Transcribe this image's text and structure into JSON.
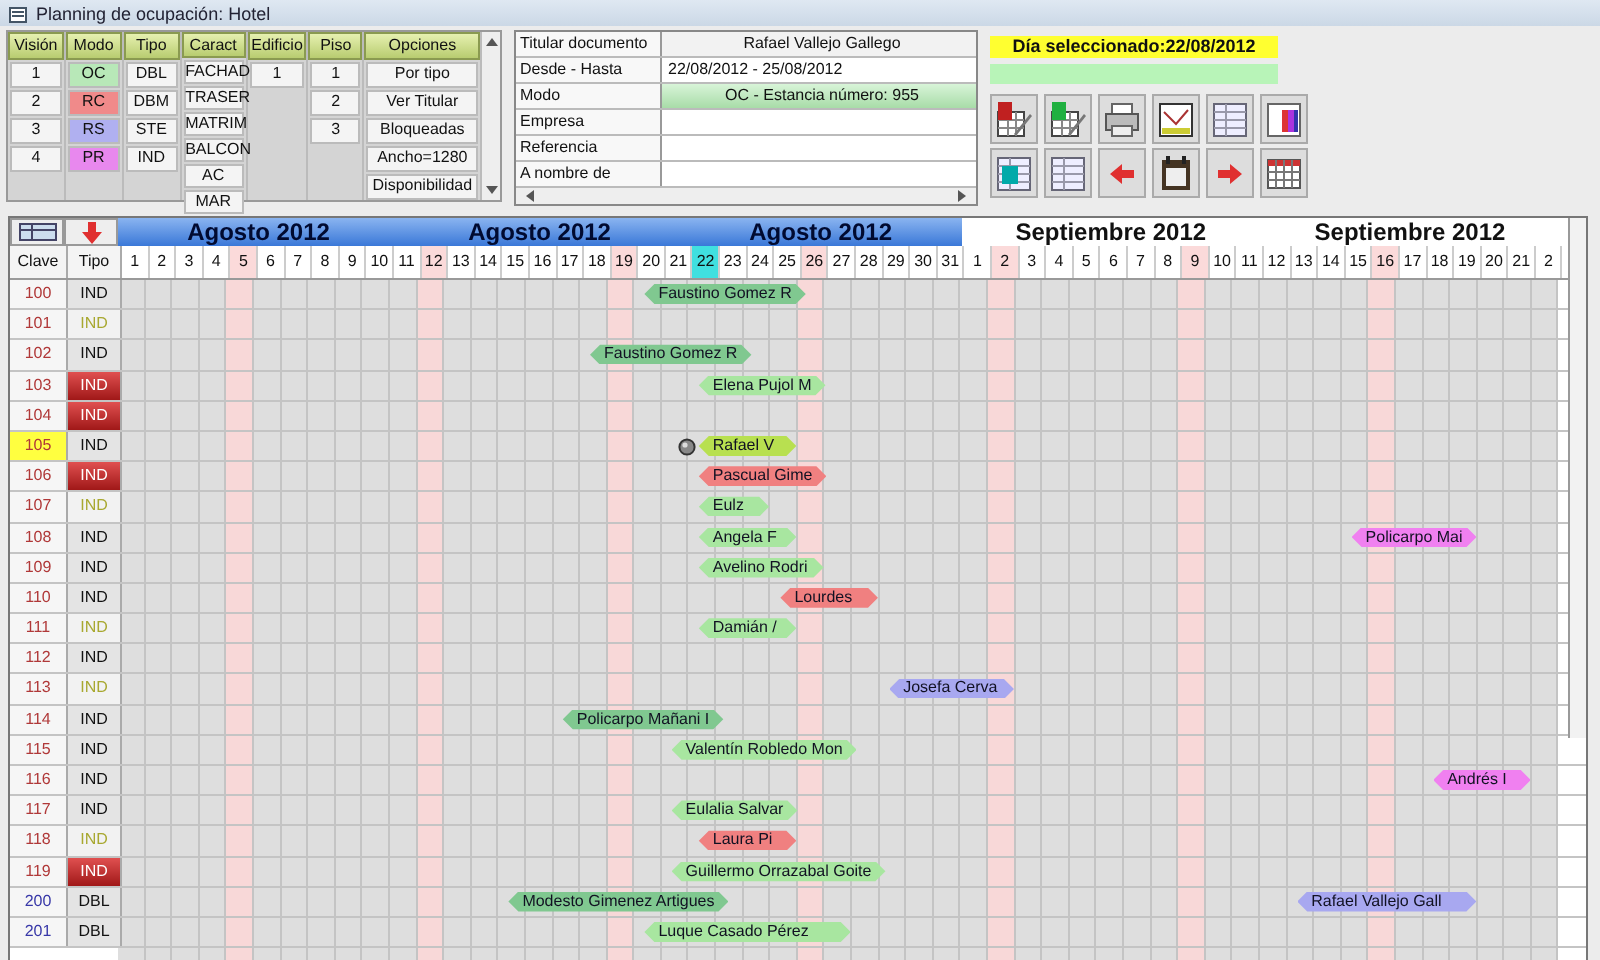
{
  "window": {
    "title": "Planning de ocupación: Hotel"
  },
  "filters": [
    {
      "header": "Visión",
      "items": [
        {
          "label": "1"
        },
        {
          "label": "2"
        },
        {
          "label": "3"
        },
        {
          "label": "4"
        }
      ]
    },
    {
      "header": "Modo",
      "items": [
        {
          "label": "OC",
          "color": "#b8e8b8"
        },
        {
          "label": "RC",
          "color": "#f08a8a"
        },
        {
          "label": "RS",
          "color": "#b0b0f0"
        },
        {
          "label": "PR",
          "color": "#e888ee"
        }
      ]
    },
    {
      "header": "Tipo",
      "items": [
        {
          "label": "DBL"
        },
        {
          "label": "DBM"
        },
        {
          "label": "STE"
        },
        {
          "label": "IND"
        }
      ]
    },
    {
      "header": "Caract",
      "items": [
        {
          "label": "FACHAD"
        },
        {
          "label": "TRASER"
        },
        {
          "label": "MATRIM"
        },
        {
          "label": "BALCON"
        },
        {
          "label": "AC"
        },
        {
          "label": "MAR"
        }
      ]
    },
    {
      "header": "Edificio",
      "items": [
        {
          "label": "1"
        }
      ]
    },
    {
      "header": "Piso",
      "items": [
        {
          "label": "1"
        },
        {
          "label": "2"
        },
        {
          "label": "3"
        }
      ]
    },
    {
      "header": "Opciones",
      "items": [
        {
          "label": "Por tipo"
        },
        {
          "label": "Ver Titular"
        },
        {
          "label": "Bloqueadas"
        },
        {
          "label": "Ancho=1280"
        },
        {
          "label": "Disponibilidad"
        }
      ]
    }
  ],
  "details": [
    {
      "label": "Titular documento",
      "value": "Rafael Vallejo Gallego",
      "kind": "center"
    },
    {
      "label": "Desde - Hasta",
      "value": "22/08/2012 - 25/08/2012",
      "kind": "left"
    },
    {
      "label": "Modo",
      "value": "OC - Estancia número: 955",
      "kind": "highlight"
    },
    {
      "label": "Empresa",
      "kind": "left"
    },
    {
      "label": "Referencia",
      "kind": "left"
    },
    {
      "label": "A nombre de",
      "kind": "left"
    }
  ],
  "selected_day": "Día seleccionado:22/08/2012",
  "toolbar": [
    {
      "kind": "edit-red"
    },
    {
      "kind": "edit-green"
    },
    {
      "kind": "printer"
    },
    {
      "kind": "chart"
    },
    {
      "kind": "table"
    },
    {
      "kind": "colors"
    },
    {
      "kind": "list-c"
    },
    {
      "kind": "list"
    },
    {
      "kind": "left"
    },
    {
      "kind": "calendar"
    },
    {
      "kind": "right"
    },
    {
      "kind": "grid"
    }
  ],
  "columns": {
    "clave": "Clave",
    "tipo": "Tipo"
  },
  "months": [
    {
      "labels": [
        "Agosto 2012",
        "Agosto 2012",
        "Agosto 2012"
      ],
      "highlighted": true,
      "days": [
        {
          "label": "1",
          "sunday": false,
          "selected": false
        },
        {
          "label": "2",
          "sunday": false,
          "selected": false
        },
        {
          "label": "3",
          "sunday": false,
          "selected": false
        },
        {
          "label": "4",
          "sunday": false,
          "selected": false
        },
        {
          "label": "5",
          "sunday": true,
          "selected": false
        },
        {
          "label": "6",
          "sunday": false,
          "selected": false
        },
        {
          "label": "7",
          "sunday": false,
          "selected": false
        },
        {
          "label": "8",
          "sunday": false,
          "selected": false
        },
        {
          "label": "9",
          "sunday": false,
          "selected": false
        },
        {
          "label": "10",
          "sunday": false,
          "selected": false
        },
        {
          "label": "11",
          "sunday": false,
          "selected": false
        },
        {
          "label": "12",
          "sunday": true,
          "selected": false
        },
        {
          "label": "13",
          "sunday": false,
          "selected": false
        },
        {
          "label": "14",
          "sunday": false,
          "selected": false
        },
        {
          "label": "15",
          "sunday": false,
          "selected": false
        },
        {
          "label": "16",
          "sunday": false,
          "selected": false
        },
        {
          "label": "17",
          "sunday": false,
          "selected": false
        },
        {
          "label": "18",
          "sunday": false,
          "selected": false
        },
        {
          "label": "19",
          "sunday": true,
          "selected": false
        },
        {
          "label": "20",
          "sunday": false,
          "selected": false
        },
        {
          "label": "21",
          "sunday": false,
          "selected": false
        },
        {
          "label": "22",
          "sunday": false,
          "selected": true
        },
        {
          "label": "23",
          "sunday": false,
          "selected": false
        },
        {
          "label": "24",
          "sunday": false,
          "selected": false
        },
        {
          "label": "25",
          "sunday": false,
          "selected": false
        },
        {
          "label": "26",
          "sunday": true,
          "selected": false
        },
        {
          "label": "27",
          "sunday": false,
          "selected": false
        },
        {
          "label": "28",
          "sunday": false,
          "selected": false
        },
        {
          "label": "29",
          "sunday": false,
          "selected": false
        },
        {
          "label": "30",
          "sunday": false,
          "selected": false
        },
        {
          "label": "31",
          "sunday": false,
          "selected": false
        }
      ]
    },
    {
      "labels": [
        "Septiembre 2012",
        "Septiembre 2012"
      ],
      "highlighted": false,
      "days": [
        {
          "label": "1",
          "sunday": false,
          "selected": false
        },
        {
          "label": "2",
          "sunday": true,
          "selected": false
        },
        {
          "label": "3",
          "sunday": false,
          "selected": false
        },
        {
          "label": "4",
          "sunday": false,
          "selected": false
        },
        {
          "label": "5",
          "sunday": false,
          "selected": false
        },
        {
          "label": "6",
          "sunday": false,
          "selected": false
        },
        {
          "label": "7",
          "sunday": false,
          "selected": false
        },
        {
          "label": "8",
          "sunday": false,
          "selected": false
        },
        {
          "label": "9",
          "sunday": true,
          "selected": false
        },
        {
          "label": "10",
          "sunday": false,
          "selected": false
        },
        {
          "label": "11",
          "sunday": false,
          "selected": false
        },
        {
          "label": "12",
          "sunday": false,
          "selected": false
        },
        {
          "label": "13",
          "sunday": false,
          "selected": false
        },
        {
          "label": "14",
          "sunday": false,
          "selected": false
        },
        {
          "label": "15",
          "sunday": false,
          "selected": false
        },
        {
          "label": "16",
          "sunday": true,
          "selected": false
        },
        {
          "label": "17",
          "sunday": false,
          "selected": false
        },
        {
          "label": "18",
          "sunday": false,
          "selected": false
        },
        {
          "label": "19",
          "sunday": false,
          "selected": false
        },
        {
          "label": "20",
          "sunday": false,
          "selected": false
        },
        {
          "label": "21",
          "sunday": false,
          "selected": false
        },
        {
          "label": "2",
          "sunday": false,
          "selected": false
        }
      ]
    }
  ],
  "rooms": [
    {
      "clave": "100",
      "tipo": "IND",
      "kind": "normal",
      "selected": false,
      "color": "#b03838",
      "bookings": [
        {
          "guest": "Faustino Gomez R",
          "color": "#80c890",
          "pinned": false
        }
      ]
    },
    {
      "clave": "101",
      "tipo": "IND",
      "kind": "pale",
      "selected": false,
      "color": "#b03838"
    },
    {
      "clave": "102",
      "tipo": "IND",
      "kind": "normal",
      "selected": false,
      "color": "#b03838",
      "bookings": [
        {
          "guest": "Faustino Gomez R",
          "color": "#80c890",
          "pinned": false
        }
      ]
    },
    {
      "clave": "103",
      "tipo": "IND",
      "kind": "blocked",
      "selected": false,
      "color": "#b03838",
      "bookings": [
        {
          "guest": "Elena Pujol M",
          "color": "#a8e6a0",
          "pinned": false
        }
      ]
    },
    {
      "clave": "104",
      "tipo": "IND",
      "kind": "blocked",
      "selected": false,
      "color": "#b03838"
    },
    {
      "clave": "105",
      "tipo": "IND",
      "kind": "normal",
      "selected": true,
      "color": "#b03838",
      "bookings": [
        {
          "guest": "Rafael V",
          "color": "#b8e050",
          "pinned": true
        }
      ]
    },
    {
      "clave": "106",
      "tipo": "IND",
      "kind": "blocked",
      "selected": false,
      "color": "#b03838",
      "bookings": [
        {
          "guest": "Pascual Gime",
          "color": "#f08080",
          "pinned": false
        }
      ]
    },
    {
      "clave": "107",
      "tipo": "IND",
      "kind": "pale",
      "selected": false,
      "color": "#b03838",
      "bookings": [
        {
          "guest": "Eulz",
          "color": "#a8e6a0",
          "pinned": false
        }
      ]
    },
    {
      "clave": "108",
      "tipo": "IND",
      "kind": "normal",
      "selected": false,
      "color": "#b03838",
      "bookings": [
        {
          "guest": "Angela F",
          "color": "#a8e6a0",
          "pinned": false
        },
        {
          "guest": "Policarpo Mai",
          "color": "#f080f0",
          "pinned": false
        }
      ]
    },
    {
      "clave": "109",
      "tipo": "IND",
      "kind": "normal",
      "selected": false,
      "color": "#b03838",
      "bookings": [
        {
          "guest": "Avelino Rodri",
          "color": "#a8e6a0",
          "pinned": false
        }
      ]
    },
    {
      "clave": "110",
      "tipo": "IND",
      "kind": "normal",
      "selected": false,
      "color": "#b03838",
      "bookings": [
        {
          "guest": "Lourdes",
          "color": "#f08080",
          "pinned": false
        }
      ]
    },
    {
      "clave": "111",
      "tipo": "IND",
      "kind": "pale",
      "selected": false,
      "color": "#b03838",
      "bookings": [
        {
          "guest": "Damián /",
          "color": "#a8e6a0",
          "pinned": false
        }
      ]
    },
    {
      "clave": "112",
      "tipo": "IND",
      "kind": "normal",
      "selected": false,
      "color": "#b03838"
    },
    {
      "clave": "113",
      "tipo": "IND",
      "kind": "pale",
      "selected": false,
      "color": "#b03838",
      "bookings": [
        {
          "guest": "Josefa Cerva",
          "color": "#a8a8f0",
          "pinned": false
        }
      ]
    },
    {
      "clave": "114",
      "tipo": "IND",
      "kind": "normal",
      "selected": false,
      "color": "#b03838",
      "bookings": [
        {
          "guest": "Policarpo Mañani I",
          "color": "#80c890",
          "pinned": false
        }
      ]
    },
    {
      "clave": "115",
      "tipo": "IND",
      "kind": "normal",
      "selected": false,
      "color": "#b03838",
      "bookings": [
        {
          "guest": "Valentín Robledo Mon",
          "color": "#a8e6a0",
          "pinned": false
        }
      ]
    },
    {
      "clave": "116",
      "tipo": "IND",
      "kind": "normal",
      "selected": false,
      "color": "#b03838",
      "bookings": [
        {
          "guest": "Andrés I",
          "color": "#f080f0",
          "pinned": false
        }
      ]
    },
    {
      "clave": "117",
      "tipo": "IND",
      "kind": "normal",
      "selected": false,
      "color": "#b03838",
      "bookings": [
        {
          "guest": "Eulalia Salvar",
          "color": "#a8e6a0",
          "pinned": false
        }
      ]
    },
    {
      "clave": "118",
      "tipo": "IND",
      "kind": "pale",
      "selected": false,
      "color": "#b03838",
      "bookings": [
        {
          "guest": "Laura Pi",
          "color": "#f08080",
          "pinned": false
        }
      ]
    },
    {
      "clave": "119",
      "tipo": "IND",
      "kind": "blocked",
      "selected": false,
      "color": "#b03838",
      "bookings": [
        {
          "guest": "Guillermo Orrazabal Goite",
          "color": "#a8e6a0",
          "pinned": false
        }
      ]
    },
    {
      "clave": "200",
      "tipo": "DBL",
      "kind": "normal",
      "selected": false,
      "color": "#3838a8",
      "bookings": [
        {
          "guest": "Modesto Gimenez Artigues",
          "color": "#80c890",
          "pinned": false
        },
        {
          "guest": "Rafael Vallejo Gall",
          "color": "#a8a8f0",
          "pinned": false
        }
      ]
    },
    {
      "clave": "201",
      "tipo": "DBL",
      "kind": "normal",
      "selected": false,
      "color": "#3838a8",
      "bookings": [
        {
          "guest": "Luque Casado Pérez",
          "color": "#a8e6a0",
          "pinned": false
        }
      ]
    }
  ]
}
